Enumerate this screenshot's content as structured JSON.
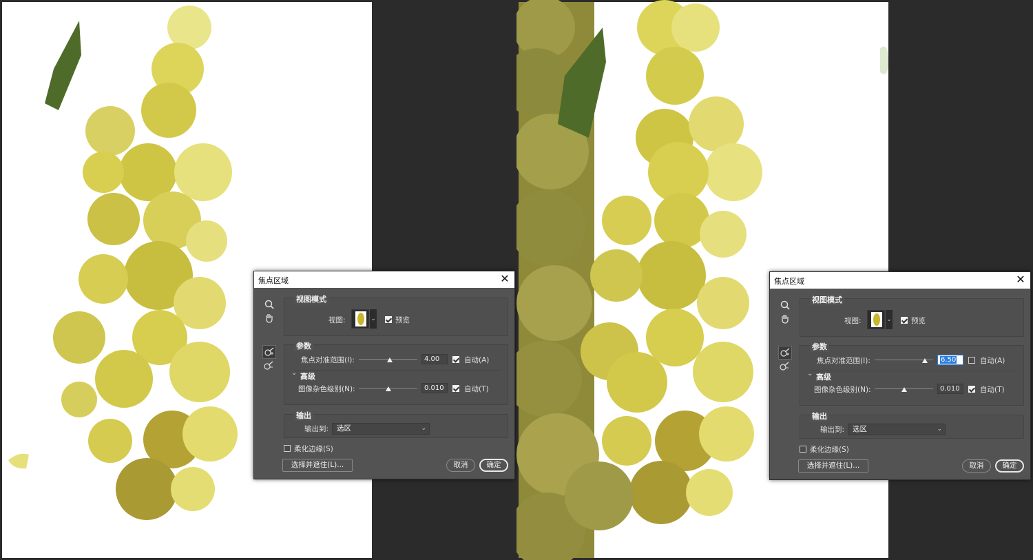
{
  "panels": [
    {
      "id": "left",
      "dialog": {
        "title": "焦点区域",
        "view_mode_title": "视图模式",
        "view_label": "视图:",
        "preview_label": "预览",
        "preview_checked": true,
        "params_title": "参数",
        "focus_range_label": "焦点对准范围(I):",
        "focus_range_value": "4.00",
        "focus_range_level": 0.53,
        "focus_range_value_selected": false,
        "auto_a_label": "自动(A)",
        "auto_a_checked": true,
        "advanced_title": "高级",
        "noise_label": "图像杂色级别(N):",
        "noise_value": "0.010",
        "noise_level": 0.5,
        "auto_t_label": "自动(T)",
        "auto_t_checked": true,
        "output_title": "输出",
        "output_to_label": "输出到:",
        "output_to_value": "选区",
        "soften_label": "柔化边缘(S)",
        "soften_checked": false,
        "select_mask_button": "选择并遮住(L)...",
        "cancel_button": "取消",
        "ok_button": "确定"
      }
    },
    {
      "id": "right",
      "dialog": {
        "title": "焦点区域",
        "view_mode_title": "视图模式",
        "view_label": "视图:",
        "preview_label": "预览",
        "preview_checked": true,
        "params_title": "参数",
        "focus_range_label": "焦点对准范围(I):",
        "focus_range_value": "6.50",
        "focus_range_level": 0.86,
        "focus_range_value_selected": true,
        "auto_a_label": "自动(A)",
        "auto_a_checked": false,
        "advanced_title": "高级",
        "noise_label": "图像杂色级别(N):",
        "noise_value": "0.010",
        "noise_level": 0.5,
        "auto_t_label": "自动(T)",
        "auto_t_checked": true,
        "output_title": "输出",
        "output_to_label": "输出到:",
        "output_to_value": "选区",
        "soften_label": "柔化边缘(S)",
        "soften_checked": false,
        "select_mask_button": "选择并遮住(L)...",
        "cancel_button": "取消",
        "ok_button": "确定"
      }
    }
  ],
  "colors": {
    "dialog_bg": "#535353",
    "workspace": "#2b2b2b",
    "grape": "#d9d04a",
    "leaf": "#4f6b2a"
  },
  "icons": [
    "zoom-icon",
    "hand-icon",
    "focus-area-add-icon",
    "focus-area-subtract-icon",
    "close-icon",
    "chevron-down-icon"
  ]
}
